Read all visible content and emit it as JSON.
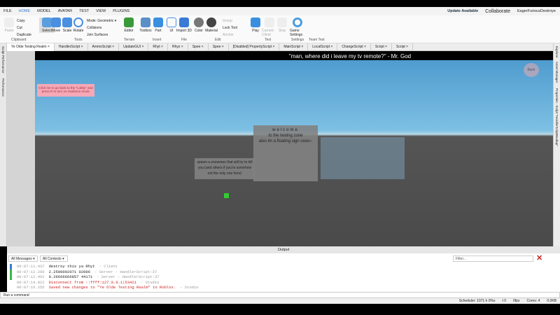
{
  "menu": {
    "file": "FILE",
    "items": [
      "HOME",
      "MODEL",
      "AVATAR",
      "TEST",
      "VIEW",
      "PLUGINS"
    ],
    "update": "Update Available",
    "collaborate": "Collaborate",
    "user": "EagerFuriousDestroye"
  },
  "ribbon": {
    "clipboard": {
      "paste": "Paste",
      "copy": "Copy",
      "cut": "Cut",
      "duplicate": "Duplicate",
      "label": "Clipboard"
    },
    "tools": {
      "select": "Select",
      "move": "Move",
      "scale": "Scale",
      "rotate": "Rotate",
      "mode": "Mode:",
      "mode_value": "Geometric",
      "collisions": "Collisions",
      "join": "Join Surfaces",
      "label": "Tools"
    },
    "terrain": {
      "editor": "Editor",
      "label": "Terrain"
    },
    "insert": {
      "toolbox": "Toolbox",
      "part": "Part",
      "ui": "UI",
      "label": "Insert"
    },
    "file": {
      "import": "Import 3D",
      "label": "File"
    },
    "edit": {
      "color": "Color",
      "material": "Material",
      "group": "Group",
      "lock": "Lock Tool",
      "anchor": "Anchor",
      "label": "Edit"
    },
    "test": {
      "play": "Play",
      "client": "Current: Client",
      "stop": "Stop",
      "label": "Test"
    },
    "settings": {
      "game": "Game Settings",
      "label": "Settings",
      "team": "Team Test"
    }
  },
  "tabs": [
    "Ye Olde Testing Realm",
    "HandlerScript",
    "AmmoScript",
    "UpdateGUI",
    "Rhyt",
    "Rhyz",
    "Spee",
    "Spee",
    "[Disabled] PropertyScript",
    "MainScript",
    "LocalScript",
    "ChangeScript",
    "Script",
    "Script"
  ],
  "left_tabs": [
    "Script Performance",
    "Performance"
  ],
  "right_tabs": [
    "Explorer",
    "Asset Manager",
    "Properties - Script \"HandlerScriptBackup\""
  ],
  "viewport": {
    "caption": "\"man, where did i leave my tv remote?\" - Mr. God",
    "lobby_button": "Click me to go back to the \"Lobby\" and press R to turn on mediocre music",
    "back_button": "Back",
    "welcome_title": "welcome",
    "welcome_lines": [
      "to the testing zone",
      "also im a floating sign oooo~"
    ],
    "snowman_sign": "spawn a snowman that will try to kill you (and others if you're somehow not the only one here)"
  },
  "output": {
    "title": "Output",
    "filter_messages": "All Messages",
    "filter_contexts": "All Contexts",
    "filter_placeholder": "Filter...",
    "logs": [
      {
        "time": "00:07:11.437",
        "msg": "destroy this ya Rhyt",
        "src": "- Client",
        "color": "#222",
        "bar": "#3a7bd5"
      },
      {
        "time": "00:07:12.260",
        "msg": "2.2500002071 02096",
        "src": "- Server - HandlerScript:37",
        "color": "#222",
        "bar": "#33bb44"
      },
      {
        "time": "00:07:12.462",
        "msg": "0.26666666857 44171",
        "src": "- Server - HandlerScript:37",
        "color": "#222",
        "bar": "#33bb44"
      },
      {
        "time": "00:07:14.822",
        "msg": "Disconnect from ::ffff:127.0.0.1|53421",
        "src": "- Studio",
        "color": "#cc2222",
        "bar": ""
      },
      {
        "time": "00:07:16.255",
        "msg": "Saved new changes to \"Ye Olde Testing Realm\" to Roblox.",
        "src": "- Studio",
        "color": "#cc2222",
        "bar": ""
      }
    ]
  },
  "command_placeholder": "Run a command",
  "status": {
    "scheduler": "Scheduler: 1071 h 0%s",
    "t": "t 0",
    "fps": "0fps",
    "cores": "Cores: 4",
    "mem": "0.0KB"
  }
}
